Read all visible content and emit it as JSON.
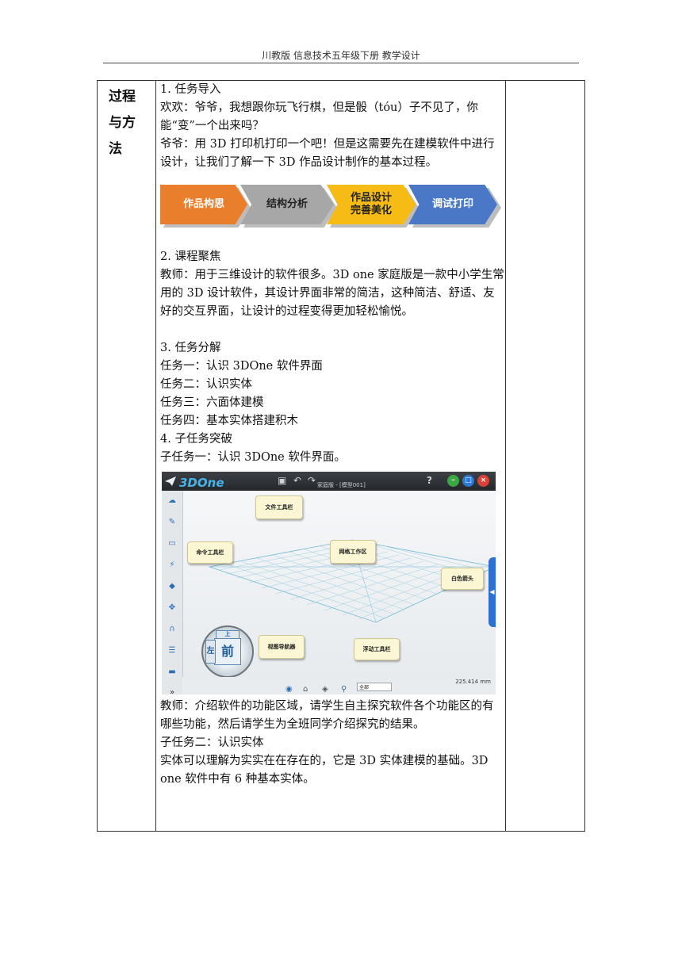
{
  "header": {
    "text": "川教版 信息技术五年级下册 教学设计"
  },
  "table": {
    "row_label": "过程与方法",
    "paragraphs": [
      "1. 任务导入",
      "欢欢：爷爷，我想跟你玩飞行棋，但是骰（tóu）子不见了，你能“变”一个出来吗？",
      "爷爷：用 3D 打印机打印一个吧！但是这需要先在建模软件中进行设计，让我们了解一下 3D 作品设计制作的基本过程。"
    ],
    "flow": {
      "steps": [
        {
          "label": "作品构思",
          "color": "#e97f2c"
        },
        {
          "label": "结构分析",
          "color": "#a7a7a7"
        },
        {
          "label": "作品设计\n完善美化",
          "color": "#f7bb16"
        },
        {
          "label": "调试打印",
          "color": "#4a78c6"
        }
      ]
    },
    "paragraphs2": [
      "2. 课程聚焦",
      "教师：用于三维设计的软件很多。3D one 家庭版是一款中小学生常用的 3D 设计软件，其设计界面非常的简洁，这种简洁、舒适、友好的交互界面，让设计的过程变得更加轻松愉悦。",
      "",
      "3. 任务分解",
      "任务一：认识 3DOne 软件界面",
      "任务二：认识实体",
      "任务三：六面体建模",
      "任务四：基本实体搭建积木",
      "4. 子任务突破",
      "子任务一：认识 3DOne 软件界面。"
    ],
    "screenshot": {
      "logo": "3DOne",
      "title": "家庭版 - [模型001]",
      "help": "?",
      "callouts": {
        "file_toolbar": "文件工具栏",
        "command_toolbar": "命令工具栏",
        "grid_area": "网格工作区",
        "white_arrow": "白色箭头",
        "view_navigator": "视图导航器",
        "float_toolbar": "浮动工具栏"
      },
      "cube_left": "左",
      "cube_front": "前",
      "cube_top": "上",
      "select_value": "全部",
      "scale_readout": "225.414 mm"
    },
    "paragraphs3": [
      "教师：介绍软件的功能区域，请学生自主探究软件各个功能区的有哪些功能，然后请学生为全班同学介绍探究的结果。",
      "子任务二：认识实体",
      "实体可以理解为实实在在存在的，它是 3D 实体建模的基础。3D one 软件中有 6 种基本实体。"
    ]
  }
}
